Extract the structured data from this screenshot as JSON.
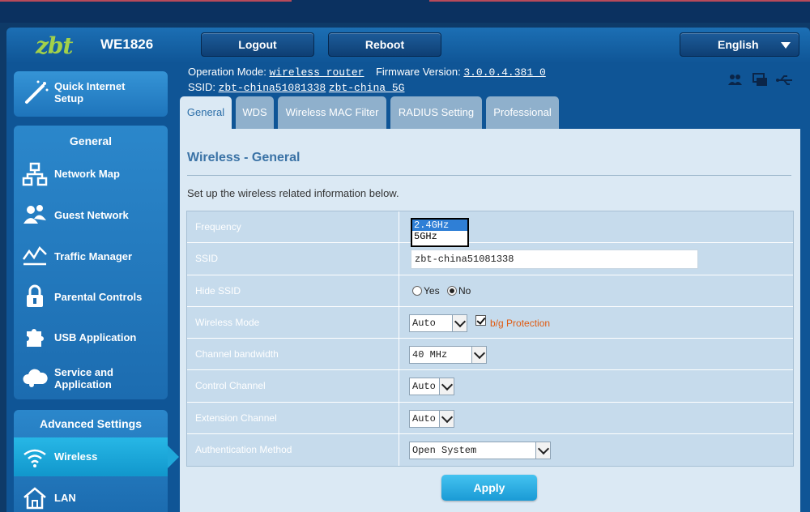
{
  "header": {
    "logo": "zbt",
    "model": "WE1826",
    "logout_label": "Logout",
    "reboot_label": "Reboot",
    "language": "English"
  },
  "status": {
    "operation_mode_label": "Operation Mode:",
    "operation_mode": "wireless router",
    "firmware_label": "Firmware Version:",
    "firmware": "3.0.0.4.381_0",
    "ssid_label": "SSID:",
    "ssid_24": "zbt-china51081338",
    "ssid_5": "zbt-china_5G"
  },
  "sidebar": {
    "quick_setup": "Quick Internet Setup",
    "general_title": "General",
    "general_items": [
      {
        "label": "Network Map",
        "icon": "network-map-icon"
      },
      {
        "label": "Guest Network",
        "icon": "guest-network-icon"
      },
      {
        "label": "Traffic Manager",
        "icon": "traffic-manager-icon"
      },
      {
        "label": "Parental Controls",
        "icon": "lock-icon"
      },
      {
        "label": "USB Application",
        "icon": "puzzle-icon"
      },
      {
        "label": "Service and Application",
        "icon": "cloud-icon"
      }
    ],
    "advanced_title": "Advanced Settings",
    "advanced_items": [
      {
        "label": "Wireless",
        "icon": "wifi-icon",
        "active": true
      },
      {
        "label": "LAN",
        "icon": "home-icon"
      }
    ]
  },
  "tabs": [
    {
      "label": "General",
      "active": true
    },
    {
      "label": "WDS"
    },
    {
      "label": "Wireless MAC Filter"
    },
    {
      "label": "RADIUS Setting"
    },
    {
      "label": "Professional"
    }
  ],
  "content": {
    "title": "Wireless - General",
    "description": "Set up the wireless related information below.",
    "rows": {
      "frequency": {
        "label": "Frequency",
        "options": [
          "2.4GHz",
          "5GHz"
        ],
        "highlighted": "2.4GHz"
      },
      "ssid": {
        "label": "SSID",
        "value": "zbt-china51081338"
      },
      "hide_ssid": {
        "label": "Hide SSID",
        "yes": "Yes",
        "no": "No",
        "selected": "No"
      },
      "wireless_mode": {
        "label": "Wireless Mode",
        "value": "Auto",
        "protection_label": "b/g Protection",
        "protection_checked": true
      },
      "channel_bandwidth": {
        "label": "Channel bandwidth",
        "value": "40 MHz"
      },
      "control_channel": {
        "label": "Control Channel",
        "value": "Auto"
      },
      "extension_channel": {
        "label": "Extension Channel",
        "value": "Auto"
      },
      "auth_method": {
        "label": "Authentication Method",
        "value": "Open System"
      }
    },
    "apply_label": "Apply"
  },
  "colors": {
    "accent": "#1197cc",
    "panel": "#dbe9f4",
    "row": "#c6dbec",
    "protection_text": "#e05a10"
  }
}
